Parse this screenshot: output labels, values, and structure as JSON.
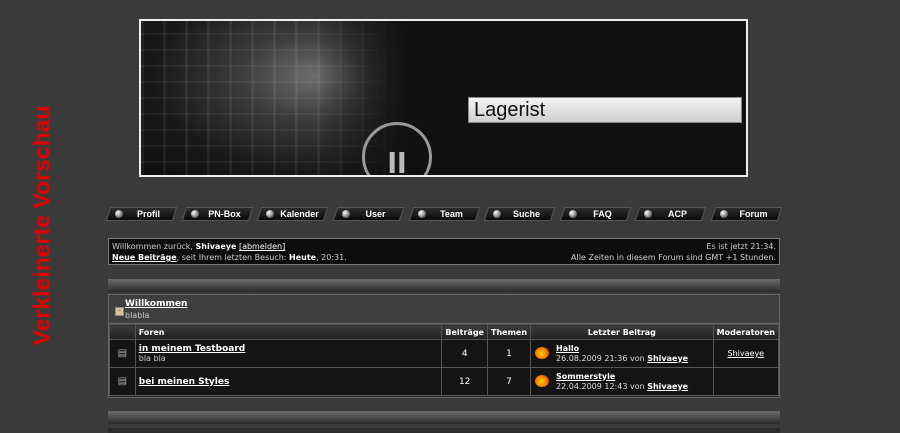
{
  "side_title": "Verkleinerte Vorschau",
  "banner": {
    "title": "Lagerist",
    "logo_glyph": "ꞁꞁ"
  },
  "nav": [
    {
      "label": "Profil"
    },
    {
      "label": "PN-Box"
    },
    {
      "label": "Kalender"
    },
    {
      "label": "User"
    },
    {
      "label": "Team"
    },
    {
      "label": "Suche"
    },
    {
      "label": "FAQ"
    },
    {
      "label": "ACP"
    },
    {
      "label": "Forum"
    }
  ],
  "info": {
    "welcome_prefix": "Willkommen zurück, ",
    "username": "Shivaeye",
    "logout": "[abmelden]",
    "new_posts": "Neue Beiträge",
    "since_text": ", seit Ihrem letzten Besuch: ",
    "last_visit_day": "Heute",
    "last_visit_time": ", 20:31.",
    "current_time": "Es ist jetzt 21:34.",
    "timezone": "Alle Zeiten in diesem Forum sind GMT +1 Stunden."
  },
  "category": {
    "title": "Willkommen",
    "description": "blabla",
    "toggle": "-"
  },
  "table": {
    "headers": [
      "Foren",
      "Beiträge",
      "Themen",
      "Letzter Beitrag",
      "Moderatoren"
    ],
    "rows": [
      {
        "name": "in meinem Testboard",
        "description": "bla bla",
        "posts": "4",
        "topics": "1",
        "last_title": "Hallo",
        "last_date": "26.08.2009 21:36 von ",
        "last_by": "Shivaeye",
        "moderator": "Shivaeye"
      },
      {
        "name": "bei meinen Styles",
        "description": "",
        "posts": "12",
        "topics": "7",
        "last_title": "Sommerstyle",
        "last_date": "22.04.2009 12:43 von ",
        "last_by": "Shivaeye",
        "moderator": ""
      }
    ]
  }
}
